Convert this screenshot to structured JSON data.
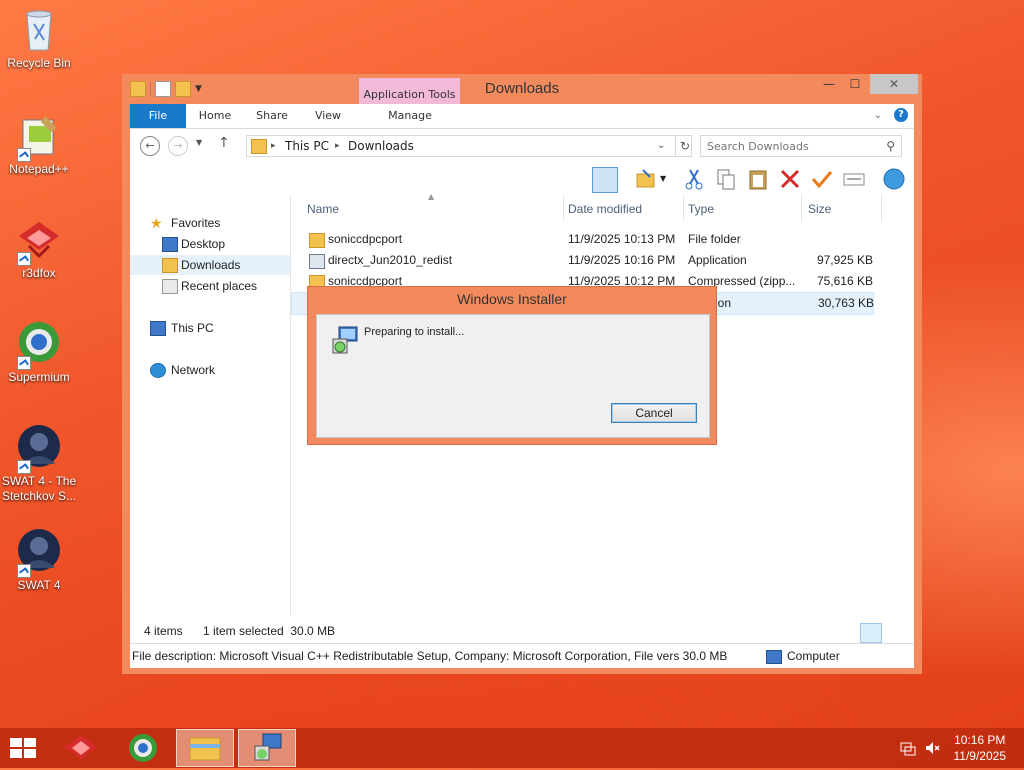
{
  "desktop": {
    "icons": [
      {
        "label": "Recycle Bin",
        "icon": "recycle-bin-icon"
      },
      {
        "label": "Notepad++",
        "icon": "notepad-plus-plus-icon"
      },
      {
        "label": "r3dfox",
        "icon": "r3dfox-icon"
      },
      {
        "label": "Supermium",
        "icon": "supermium-icon"
      },
      {
        "label": "SWAT 4 - The Stetchkov S...",
        "icon": "swat4-stetchkov-icon"
      },
      {
        "label": "SWAT 4",
        "icon": "swat4-icon"
      }
    ]
  },
  "explorer": {
    "title": "Downloads",
    "context_tab": "Application Tools",
    "tabs": [
      "File",
      "Home",
      "Share",
      "View",
      "Manage"
    ],
    "address": {
      "crumbs": [
        "This PC",
        "Downloads"
      ]
    },
    "search": {
      "placeholder": "Search Downloads"
    },
    "sidebar": {
      "favorites": "Favorites",
      "items": [
        "Desktop",
        "Downloads",
        "Recent places"
      ],
      "this_pc": "This PC",
      "network": "Network"
    },
    "columns": [
      "Name",
      "Date modified",
      "Type",
      "Size"
    ],
    "files": [
      {
        "name": "soniccdpcport",
        "date": "11/9/2025 10:13 PM",
        "type": "File folder",
        "size": ""
      },
      {
        "name": "directx_Jun2010_redist",
        "date": "11/9/2025 10:16 PM",
        "type": "Application",
        "size": "97,925 KB"
      },
      {
        "name": "soniccdpcport",
        "date": "11/9/2025 10:12 PM",
        "type": "Compressed (zipp...",
        "size": "75,616 KB"
      },
      {
        "name": "",
        "date": "",
        "type": "...cation",
        "size": "30,763 KB"
      }
    ],
    "status": {
      "items": "4 items",
      "selected": "1 item selected  30.0 MB"
    },
    "details": {
      "text": "File description: Microsoft Visual C++ Redistributable Setup, Company: Microsoft Corporation, File vers 30.0 MB",
      "location": "Computer"
    }
  },
  "installer": {
    "title": "Windows Installer",
    "message": "Preparing to install...",
    "cancel": "Cancel"
  },
  "taskbar": {
    "clock_time": "10:16 PM",
    "clock_date": "11/9/2025"
  },
  "colors": {
    "accent": "#1979ca",
    "window_border": "#f28a5e",
    "taskbar": "#be2d0f"
  }
}
